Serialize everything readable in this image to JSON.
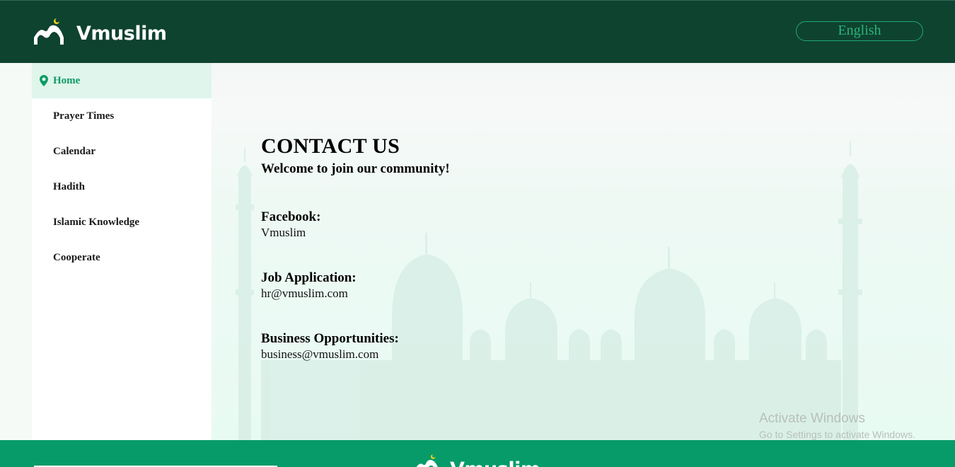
{
  "header": {
    "brand": "Vmuslim",
    "language_button": "English"
  },
  "sidebar": {
    "items": [
      {
        "label": "Home",
        "icon": "location-pin-icon",
        "active": true
      },
      {
        "label": "Prayer Times"
      },
      {
        "label": "Calendar"
      },
      {
        "label": "Hadith"
      },
      {
        "label": "Islamic Knowledge"
      },
      {
        "label": "Cooperate"
      }
    ]
  },
  "main": {
    "title": "CONTACT US",
    "subtitle": "Welcome to join our community!",
    "contacts": [
      {
        "label": "Facebook:",
        "value": "Vmuslim"
      },
      {
        "label": "Job Application:",
        "value": "hr@vmuslim.com"
      },
      {
        "label": "Business Opportunities:",
        "value": "business@vmuslim.com"
      }
    ]
  },
  "watermark": {
    "title": "Activate Windows",
    "subtitle": "Go to Settings to activate Windows."
  },
  "footer": {
    "brand": "Vmuslim"
  },
  "colors": {
    "header_bg": "#0e4330",
    "accent": "#069b69",
    "active_nav_bg": "#e0f5ec",
    "active_nav_text": "#0f9a66",
    "crescent": "#e8d21c"
  }
}
